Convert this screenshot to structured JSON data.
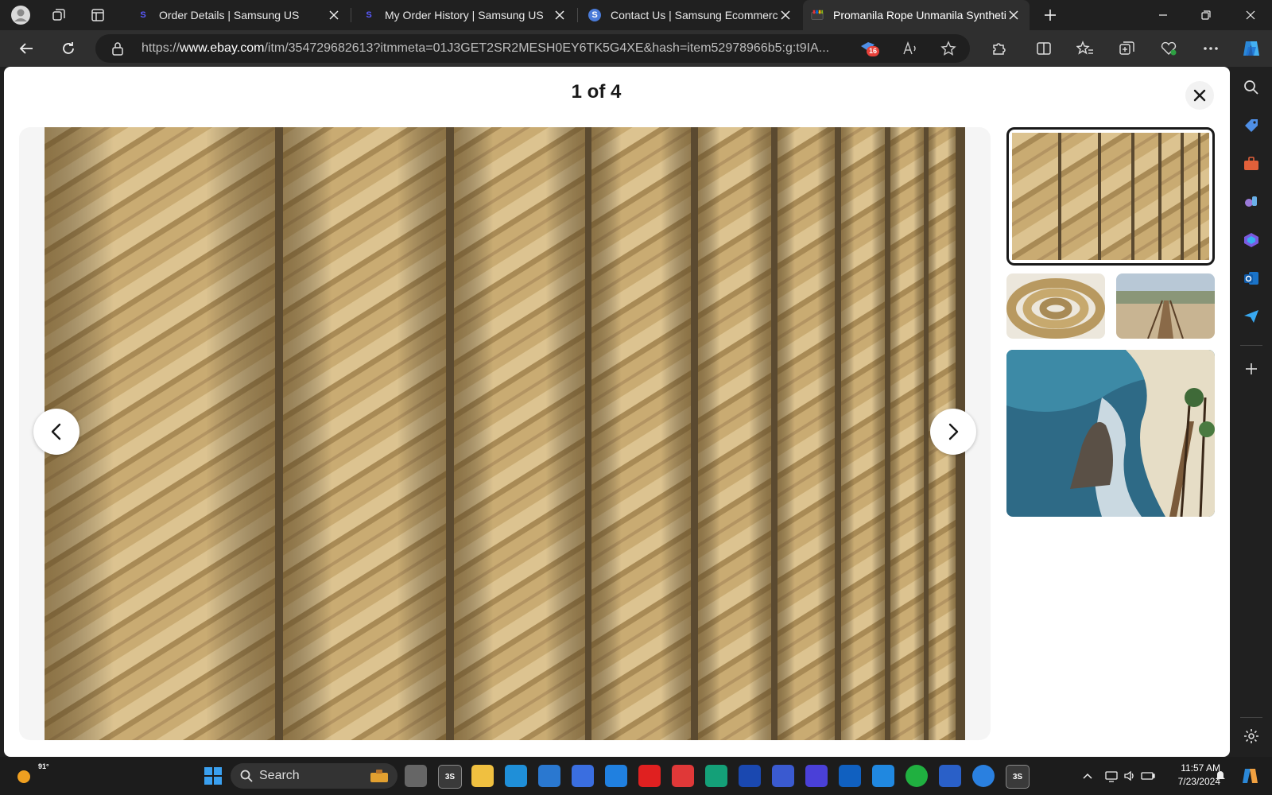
{
  "browser": {
    "tabs": [
      {
        "title": "Order Details | Samsung US",
        "favicon": "S"
      },
      {
        "title": "My Order History | Samsung US",
        "favicon": "S"
      },
      {
        "title": "Contact Us | Samsung Ecommerce",
        "favicon": "S"
      },
      {
        "title": "Promanila Rope Unmanila Synthetic",
        "favicon": ""
      }
    ],
    "active_tab": 3,
    "url_prefix": "https://",
    "url_domain": "www.ebay.com",
    "url_rest": "/itm/354729682613?itmmeta=01J3GET2SR2MESH0EY6TK5G4XE&hash=item52978966b5:g:t9IA...",
    "extension_badge": "16"
  },
  "gallery": {
    "counter": "1 of 4",
    "thumbnails": [
      {
        "name": "rope strands closeup",
        "selected": true
      },
      {
        "name": "coiled rope",
        "selected": false
      },
      {
        "name": "coastal stairway",
        "selected": false
      },
      {
        "name": "beach with rope railing",
        "selected": false
      }
    ]
  },
  "taskbar": {
    "weather_temp": "91°",
    "search_label": "Search",
    "time": "11:57 AM",
    "date": "7/23/2024"
  },
  "colors": {
    "accent": "#0078d4",
    "rope": "#c8a86e",
    "page_bg": "#ffffff",
    "chrome_bg": "#202020"
  }
}
